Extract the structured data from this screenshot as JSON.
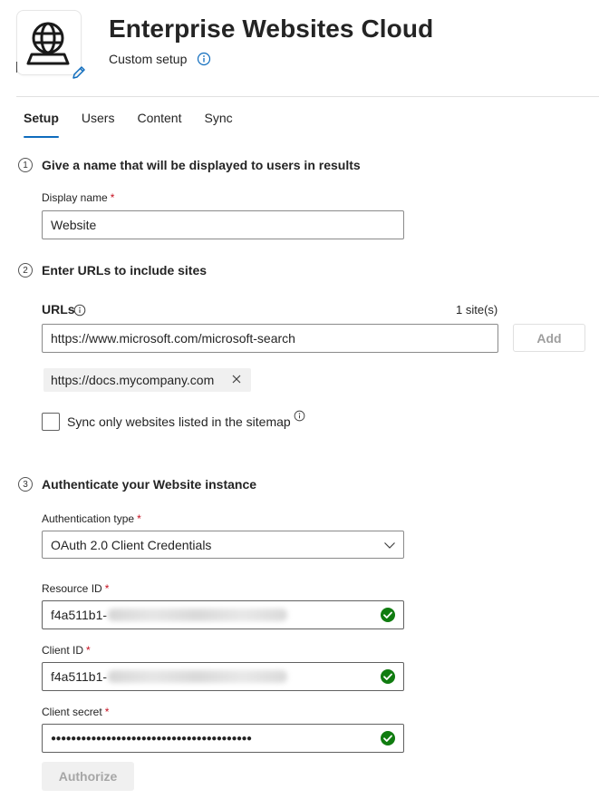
{
  "header": {
    "title": "Enterprise Websites Cloud",
    "subtitle": "Custom setup"
  },
  "tabs": [
    {
      "label": "Setup",
      "active": true
    },
    {
      "label": "Users",
      "active": false
    },
    {
      "label": "Content",
      "active": false
    },
    {
      "label": "Sync",
      "active": false
    }
  ],
  "step1": {
    "number": "1",
    "title": "Give a name that will be displayed to users in results",
    "display_name_label": "Display name",
    "display_name_value": "Website"
  },
  "step2": {
    "number": "2",
    "title": "Enter URLs to include sites",
    "urls_label": "URLs",
    "site_count": "1 site(s)",
    "url_input_value": "https://www.microsoft.com/microsoft-search",
    "add_label": "Add",
    "chip_label": "https://docs.mycompany.com",
    "sitemap_label": "Sync only websites listed in the sitemap",
    "sitemap_checked": false
  },
  "step3": {
    "number": "3",
    "title": "Authenticate your Website instance",
    "auth_type_label": "Authentication type",
    "auth_type_value": "OAuth 2.0 Client Credentials",
    "resource_id_label": "Resource ID",
    "resource_id_value": "f4a511b1-",
    "client_id_label": "Client ID",
    "client_id_value": "f4a511b1-",
    "client_secret_label": "Client secret",
    "client_secret_value": "●●●●●●●●●●●●●●●●●●●●●●●●●●●●●●●●●●●●●●●●",
    "authorize_label": "Authorize"
  },
  "required_mark": "*",
  "colors": {
    "accent": "#0f6cbd",
    "success": "#107c10",
    "required": "#c50f1f"
  },
  "icons": {
    "logo": "globe-laptop-icon",
    "edit": "pencil-icon",
    "info": "info-icon",
    "dismiss": "close-icon",
    "dropdown": "chevron-down-icon",
    "valid": "checkmark-circle-icon"
  }
}
